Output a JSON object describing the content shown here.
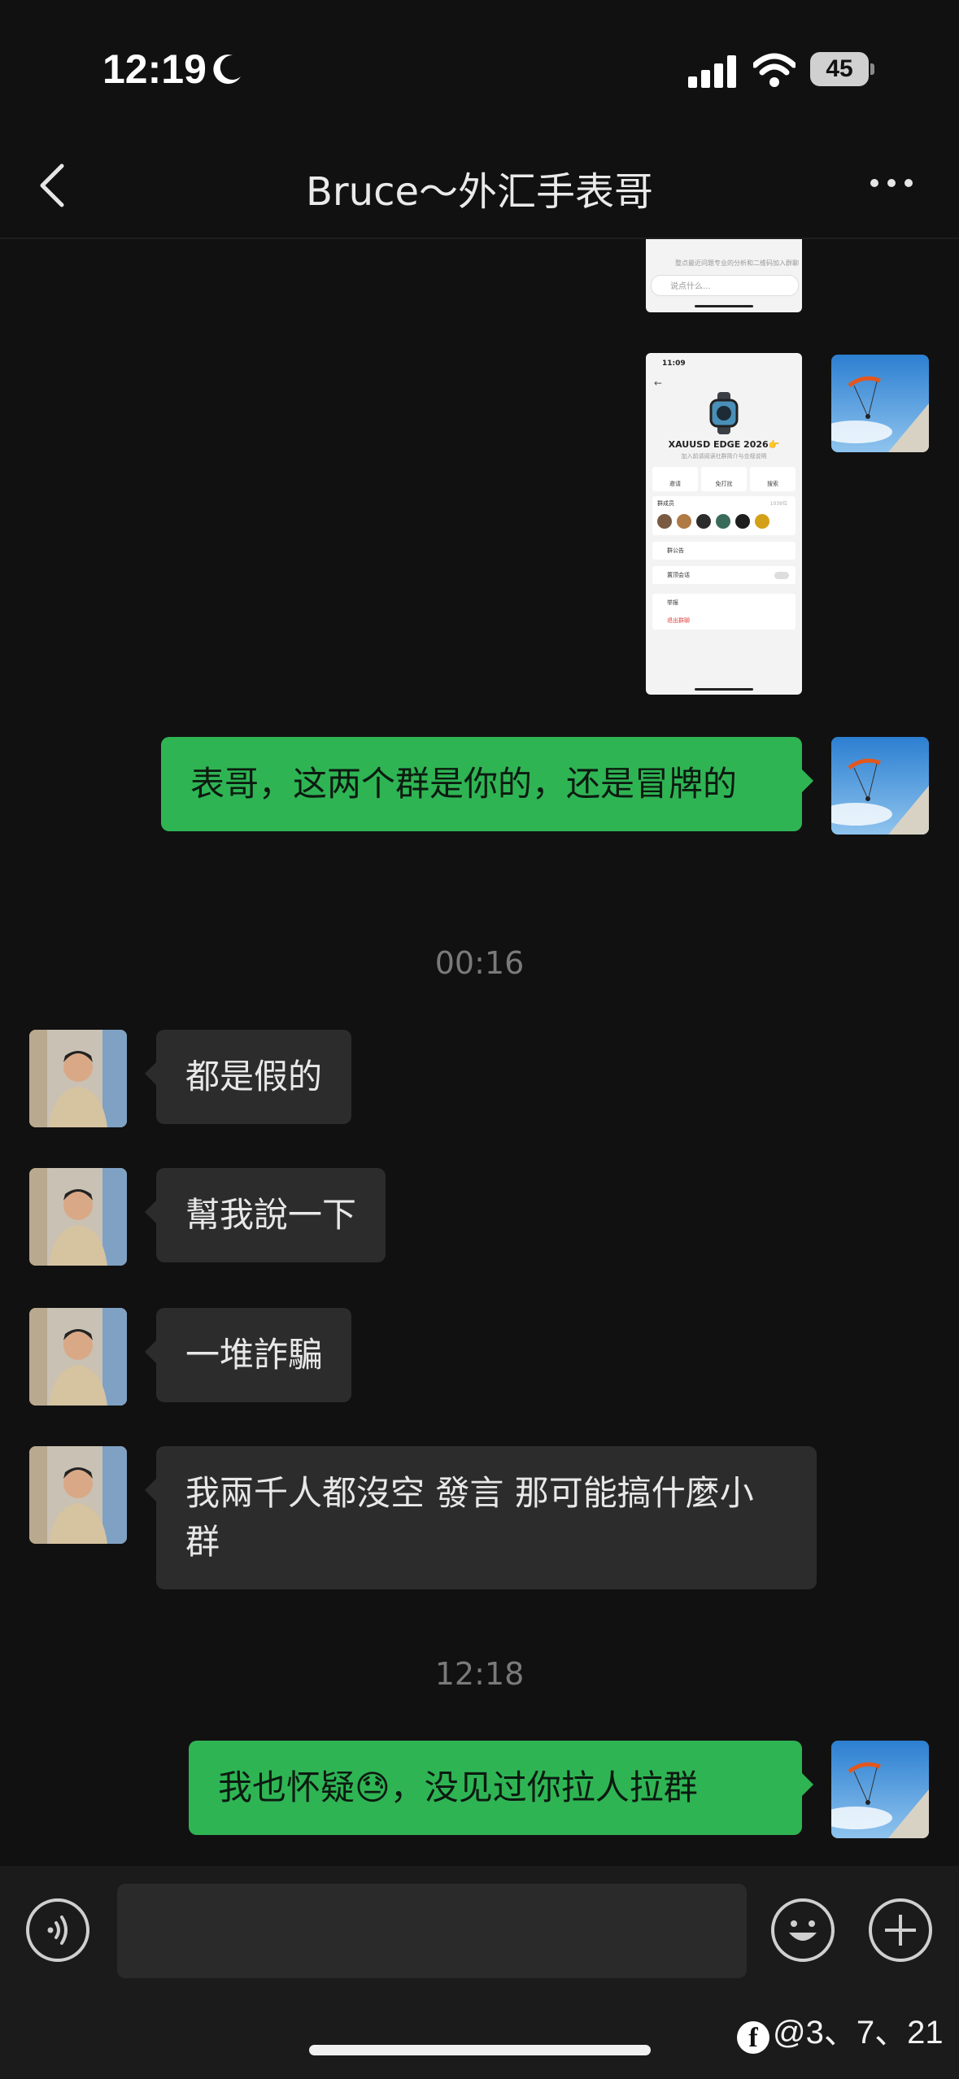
{
  "status_bar": {
    "time": "12:19",
    "battery": "45"
  },
  "header": {
    "title": "Bruce～外汇手表哥"
  },
  "shared_screenshot": {
    "placeholder": "说点什么...",
    "notice": "整点最近问题专业的分析和二维码加入群聊",
    "time": "11:09",
    "group_name": "XAUUSD EDGE 2026👉",
    "group_sub": "加入前请阅读社群简介与合规说明",
    "actions": [
      "邀请",
      "免打扰",
      "搜索"
    ],
    "members_label": "群成员",
    "members_count": "1039位",
    "rows": [
      "群公告",
      "置顶会话",
      "举报"
    ],
    "leave": "退出群聊"
  },
  "messages": [
    {
      "side": "out",
      "text": "表哥，这两个群是你的，还是冒牌的"
    },
    {
      "side": "stamp",
      "text": "00:16"
    },
    {
      "side": "in",
      "text": "都是假的"
    },
    {
      "side": "in",
      "text": "幫我說一下"
    },
    {
      "side": "in",
      "text": "一堆詐騙"
    },
    {
      "side": "in",
      "text": "我兩千人都沒空 發言 那可能搞什麼小群"
    },
    {
      "side": "stamp",
      "text": "12:18"
    },
    {
      "side": "out",
      "text": "我也怀疑😓，没见过你拉人拉群"
    }
  ],
  "watermark": {
    "text": "@3、7、21"
  },
  "colors": {
    "outgoing_bubble": "#2fb454",
    "incoming_bubble": "#2c2c2c",
    "background": "#111111"
  },
  "icons": [
    "moon-icon",
    "signal-icon",
    "wifi-icon",
    "back-chevron-icon",
    "more-icon",
    "voice-icon",
    "emoji-icon",
    "plus-icon"
  ]
}
